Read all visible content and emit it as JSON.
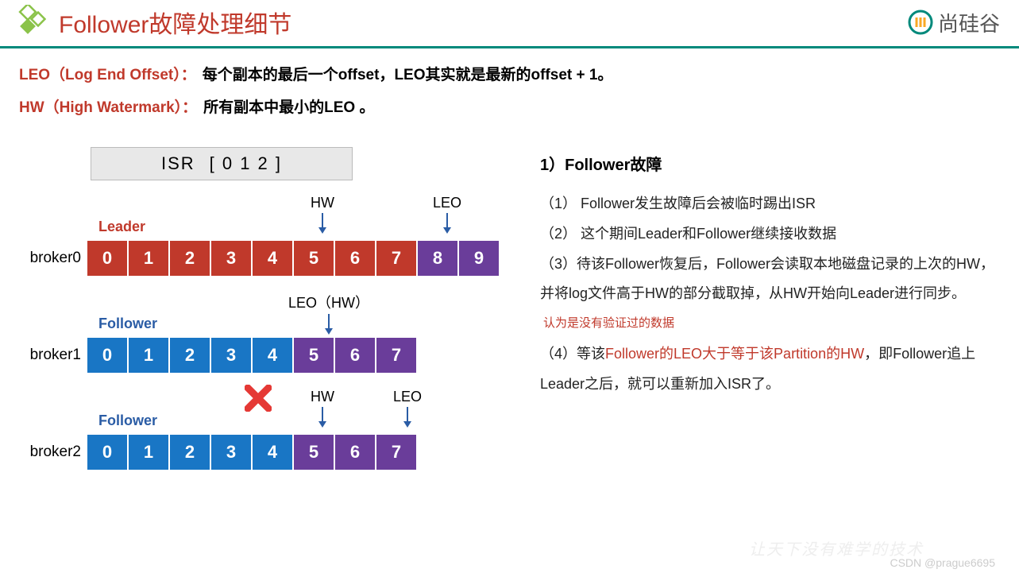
{
  "header": {
    "title": "Follower故障处理细节",
    "logo_right_text": "尚硅谷"
  },
  "definitions": {
    "leo_term": "LEO（Log End Offset）：",
    "leo_desc": "每个副本的最后一个offset，LEO其实就是最新的offset + 1。",
    "hw_term": "HW（High Watermark）：",
    "hw_desc": "所有副本中最小的LEO 。"
  },
  "isr": {
    "label": "ISR",
    "content": "[   0     1     2 ]"
  },
  "markers": {
    "hw": "HW",
    "leo": "LEO",
    "leo_hw": "LEO（HW）"
  },
  "roles": {
    "leader": "Leader",
    "follower": "Follower"
  },
  "brokers": {
    "b0_label": "broker0",
    "b1_label": "broker1",
    "b2_label": "broker2"
  },
  "chart_data": {
    "type": "table",
    "title": "Follower故障处理细节",
    "isr": [
      0,
      1,
      2
    ],
    "rows": [
      {
        "broker": "broker0",
        "role": "Leader",
        "cells": [
          0,
          1,
          2,
          3,
          4,
          5,
          6,
          7,
          8,
          9
        ],
        "hw_at": 5,
        "leo_at": 8,
        "leo_after_color": "purple",
        "base_color": "red"
      },
      {
        "broker": "broker1",
        "role": "Follower",
        "cells": [
          0,
          1,
          2,
          3,
          4,
          5,
          6,
          7
        ],
        "leo_hw_at": 5,
        "base_color": "blue",
        "alt_color": "purple"
      },
      {
        "broker": "broker2",
        "role": "Follower",
        "failed": true,
        "cells": [
          0,
          1,
          2,
          3,
          4,
          5,
          6,
          7
        ],
        "hw_at": 5,
        "leo_at": 7,
        "base_color": "blue",
        "alt_color": "purple"
      }
    ]
  },
  "cells": {
    "b0": [
      "0",
      "1",
      "2",
      "3",
      "4",
      "5",
      "6",
      "7",
      "8",
      "9"
    ],
    "b1": [
      "0",
      "1",
      "2",
      "3",
      "4",
      "5",
      "6",
      "7"
    ],
    "b2": [
      "0",
      "1",
      "2",
      "3",
      "4",
      "5",
      "6",
      "7"
    ]
  },
  "explain": {
    "heading": "1）Follower故障",
    "p1": "（1） Follower发生故障后会被临时踢出ISR",
    "p2": "（2） 这个期间Leader和Follower继续接收数据",
    "p3a": "（3）待该Follower恢复后，Follower会读取本地磁盘记录的上次的HW，并将log文件高于HW的部分截取掉，从HW开始向Leader进行同步。",
    "p3_note": "认为是没有验证过的数据",
    "p4_prefix": "（4）等该",
    "p4_red": "Follower的LEO大于等于该Partition的HW",
    "p4_suffix": "，即Follower追上Leader之后，就可以重新加入ISR了。"
  },
  "watermarks": {
    "w1": "CSDN @prague6695",
    "w2": "让天下没有难学的技术"
  }
}
